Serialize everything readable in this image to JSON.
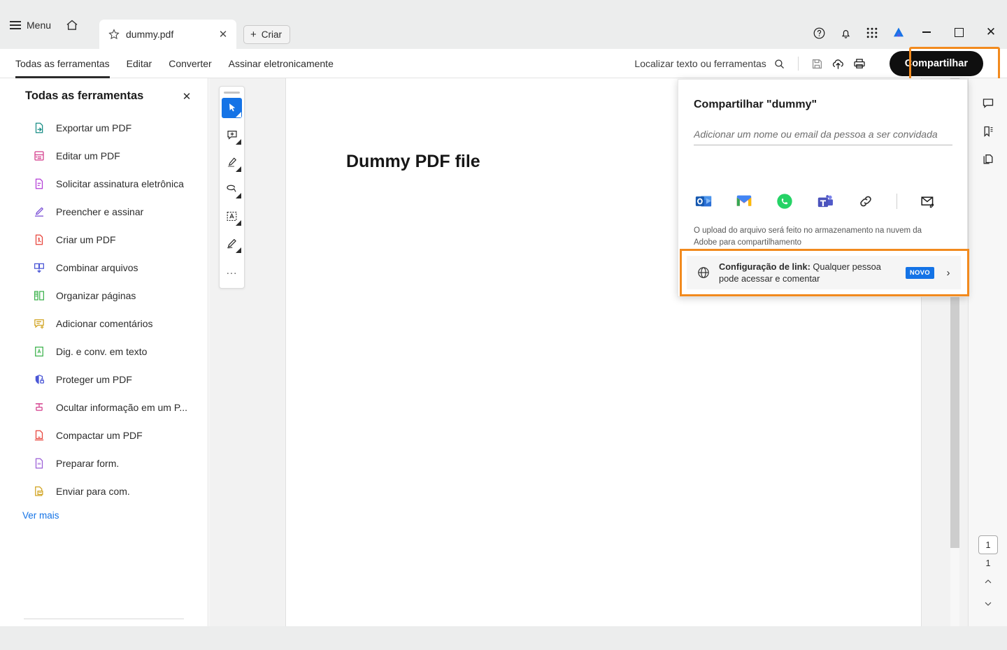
{
  "titlebar": {
    "menu_label": "Menu",
    "home_icon": "home-icon",
    "tab": {
      "title": "dummy.pdf",
      "star_icon": "star-icon",
      "close_icon": "close-icon"
    },
    "new_tab_label": "Criar",
    "icons": [
      "help-icon",
      "bell-icon",
      "app-grid-icon",
      "adobe-logo-icon"
    ],
    "window_controls": [
      "minimize",
      "maximize",
      "close"
    ]
  },
  "command_bar": {
    "tabs": [
      {
        "label": "Todas as ferramentas",
        "active": true
      },
      {
        "label": "Editar",
        "active": false
      },
      {
        "label": "Converter",
        "active": false
      },
      {
        "label": "Assinar eletronicamente",
        "active": false
      }
    ],
    "search_label": "Localizar texto ou ferramentas",
    "icons": [
      "save-icon",
      "cloud-upload-icon",
      "print-icon"
    ],
    "share_label": "Compartilhar"
  },
  "tools_panel": {
    "title": "Todas as ferramentas",
    "close_icon": "close-icon",
    "items": [
      {
        "label": "Exportar um PDF",
        "icon": "export-pdf-icon",
        "color": "#1a8e86"
      },
      {
        "label": "Editar um PDF",
        "icon": "edit-pdf-icon",
        "color": "#d43f8d"
      },
      {
        "label": "Solicitar assinatura eletrônica",
        "icon": "request-esign-icon",
        "color": "#b43fd6"
      },
      {
        "label": "Preencher e assinar",
        "icon": "fill-sign-icon",
        "color": "#7a4fd6"
      },
      {
        "label": "Criar um PDF",
        "icon": "create-pdf-icon",
        "color": "#e8453c"
      },
      {
        "label": "Combinar arquivos",
        "icon": "combine-files-icon",
        "color": "#4b57d6"
      },
      {
        "label": "Organizar páginas",
        "icon": "organize-pages-icon",
        "color": "#3fb34f"
      },
      {
        "label": "Adicionar comentários",
        "icon": "add-comments-icon",
        "color": "#d1a423"
      },
      {
        "label": "Dig. e conv. em texto",
        "icon": "scan-ocr-icon",
        "color": "#3fb34f"
      },
      {
        "label": "Proteger um PDF",
        "icon": "protect-pdf-icon",
        "color": "#4b57d6"
      },
      {
        "label": "Ocultar informação em um P...",
        "icon": "redact-icon",
        "color": "#d43f8d"
      },
      {
        "label": "Compactar um PDF",
        "icon": "compress-pdf-icon",
        "color": "#e8453c"
      },
      {
        "label": "Preparar form.",
        "icon": "prepare-form-icon",
        "color": "#9b5fd6"
      },
      {
        "label": "Enviar para com.",
        "icon": "send-for-comments-icon",
        "color": "#d1a423"
      }
    ],
    "see_more_label": "Ver mais"
  },
  "quick_toolbar": {
    "items": [
      {
        "icon": "select-cursor-icon",
        "selected": true
      },
      {
        "icon": "add-comment-icon",
        "selected": false
      },
      {
        "icon": "highlight-icon",
        "selected": false
      },
      {
        "icon": "draw-oval-icon",
        "selected": false
      },
      {
        "icon": "add-text-icon",
        "selected": false
      },
      {
        "icon": "signature-icon",
        "selected": false
      }
    ],
    "more_label": "..."
  },
  "document": {
    "page_text": "Dummy PDF file"
  },
  "right_rail": {
    "icons": [
      "comment-icon",
      "bookmark-icon",
      "pages-thumbnail-icon"
    ],
    "current_page": "1",
    "total_pages": "1",
    "prev_icon": "chevron-up-icon",
    "next_icon": "chevron-down-icon"
  },
  "share_panel": {
    "title": "Compartilhar \"dummy\"",
    "input_placeholder": "Adicionar um nome ou email da pessoa a ser convidada",
    "input_value": "",
    "apps": [
      {
        "name": "outlook-icon"
      },
      {
        "name": "gmail-icon"
      },
      {
        "name": "whatsapp-icon"
      },
      {
        "name": "teams-icon"
      },
      {
        "name": "copy-link-icon"
      },
      {
        "name": "email-attach-icon"
      }
    ],
    "note": "O upload do arquivo será feito no armazenamento na nuvem da Adobe para compartilhamento",
    "link_settings": {
      "globe_icon": "globe-icon",
      "label": "Configuração de link:",
      "value": "Qualquer pessoa pode acessar e comentar",
      "badge": "NOVO",
      "chevron": "›"
    }
  },
  "highlights": {
    "color": "#f28a1e"
  }
}
